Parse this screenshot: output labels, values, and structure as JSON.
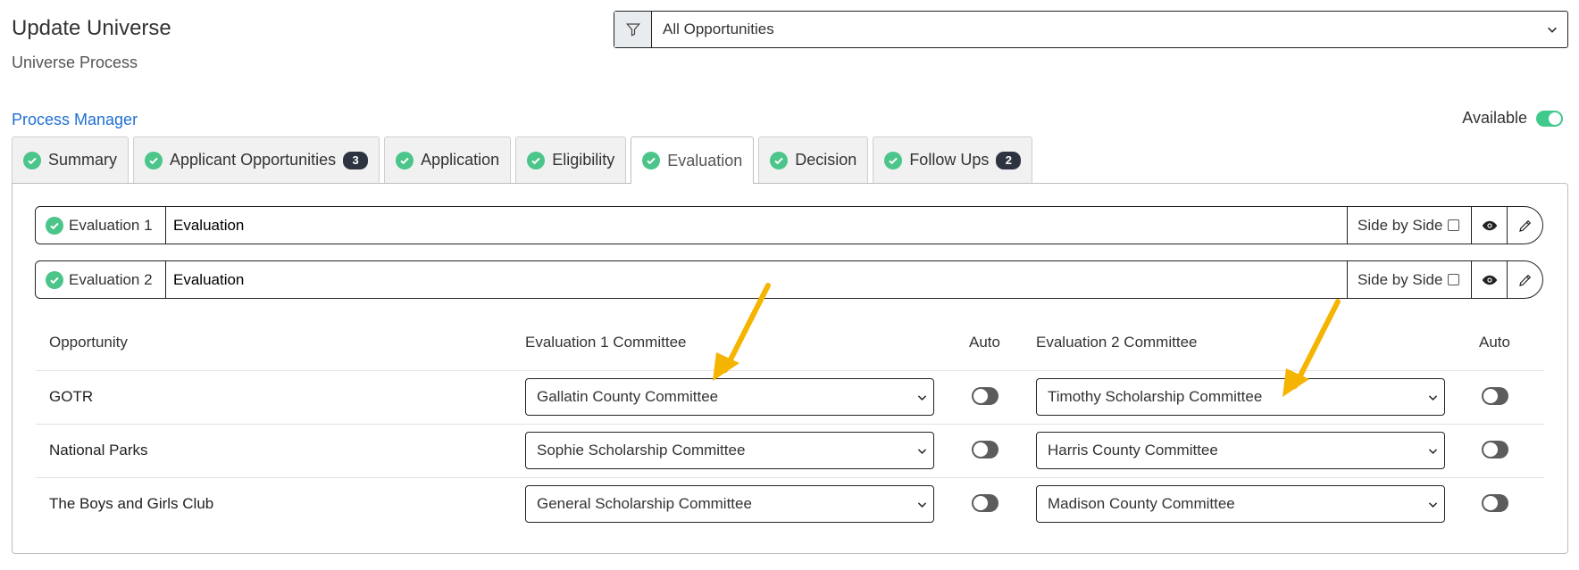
{
  "header": {
    "title": "Update Universe",
    "subtitle": "Universe Process"
  },
  "filter": {
    "icon": "filter-icon",
    "selected": "All Opportunities"
  },
  "process_manager": {
    "link_label": "Process Manager",
    "available_label": "Available",
    "available_on": true
  },
  "tabs": [
    {
      "label": "Summary",
      "badge": null
    },
    {
      "label": "Applicant Opportunities",
      "badge": "3"
    },
    {
      "label": "Application",
      "badge": null
    },
    {
      "label": "Eligibility",
      "badge": null
    },
    {
      "label": "Evaluation",
      "badge": null,
      "active": true
    },
    {
      "label": "Decision",
      "badge": null
    },
    {
      "label": "Follow Ups",
      "badge": "2"
    }
  ],
  "evaluations": [
    {
      "label": "Evaluation 1",
      "name": "Evaluation",
      "side_by_side_label": "Side by Side",
      "side_by_side": false
    },
    {
      "label": "Evaluation 2",
      "name": "Evaluation",
      "side_by_side_label": "Side by Side",
      "side_by_side": false
    }
  ],
  "grid": {
    "headers": {
      "opportunity": "Opportunity",
      "eval1_committee": "Evaluation 1 Committee",
      "auto1": "Auto",
      "eval2_committee": "Evaluation 2 Committee",
      "auto2": "Auto"
    },
    "rows": [
      {
        "opportunity": "GOTR",
        "eval1": "Gallatin County Committee",
        "auto1": false,
        "eval2": "Timothy Scholarship Committee",
        "auto2": false
      },
      {
        "opportunity": "National Parks",
        "eval1": "Sophie Scholarship Committee",
        "auto1": false,
        "eval2": "Harris County Committee",
        "auto2": false
      },
      {
        "opportunity": "The Boys and Girls Club",
        "eval1": "General Scholarship Committee",
        "auto1": false,
        "eval2": "Madison County Committee",
        "auto2": false
      }
    ]
  },
  "colors": {
    "accent_green": "#4cc58b",
    "link_blue": "#1f6fd1",
    "annotation_arrow": "#f5b400"
  }
}
